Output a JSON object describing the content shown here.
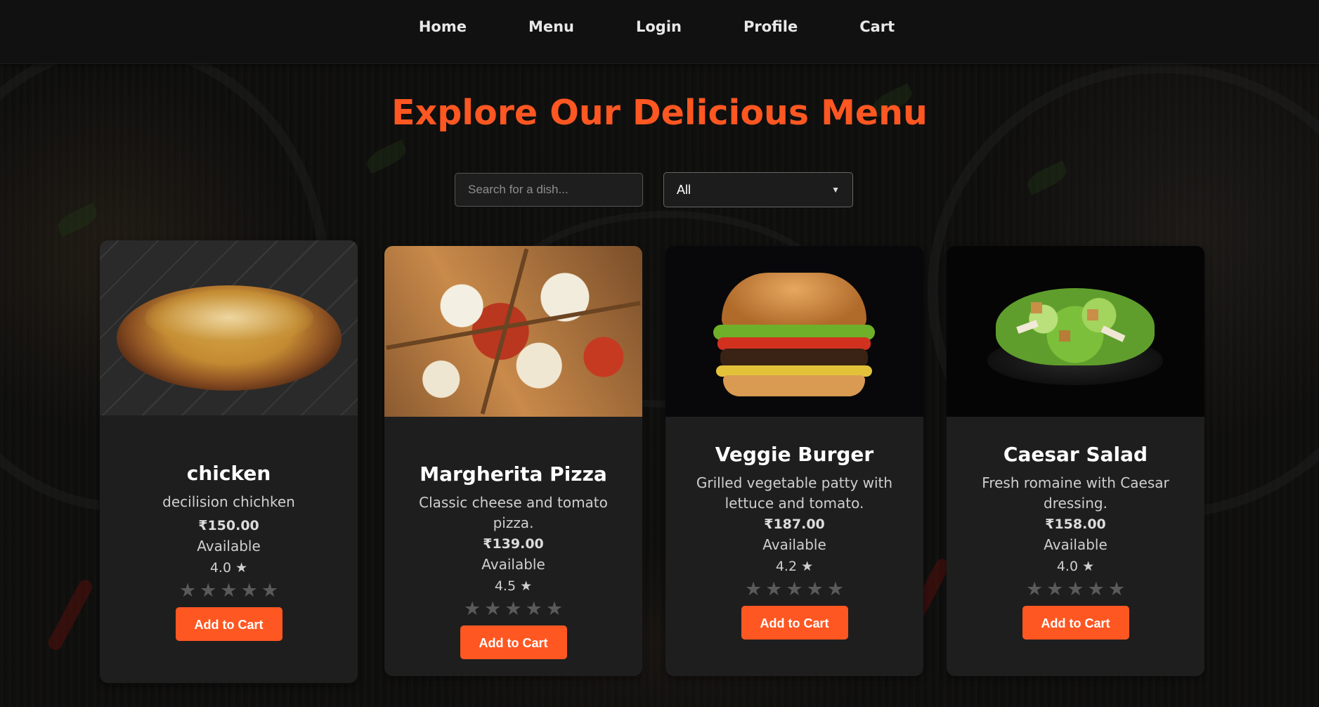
{
  "nav": {
    "items": [
      "Home",
      "Menu",
      "Login",
      "Profile",
      "Cart"
    ]
  },
  "page": {
    "title": "Explore Our Delicious Menu"
  },
  "search": {
    "placeholder": "Search for a dish..."
  },
  "filter": {
    "selected": "All"
  },
  "menu": [
    {
      "name": "chicken",
      "description": "decilision chichken",
      "price": "₹150.00",
      "status": "Available",
      "rating": "4.0 ★",
      "stars": 5,
      "button": "Add to Cart",
      "image_icon": "biryani-image"
    },
    {
      "name": "Margherita Pizza",
      "description": "Classic cheese and tomato pizza.",
      "price": "₹139.00",
      "status": "Available",
      "rating": "4.5 ★",
      "stars": 5,
      "button": "Add to Cart",
      "image_icon": "pizza-image"
    },
    {
      "name": "Veggie Burger",
      "description": "Grilled vegetable patty with lettuce and tomato.",
      "price": "₹187.00",
      "status": "Available",
      "rating": "4.2 ★",
      "stars": 5,
      "button": "Add to Cart",
      "image_icon": "burger-image"
    },
    {
      "name": "Caesar Salad",
      "description": "Fresh romaine with Caesar dressing.",
      "price": "₹158.00",
      "status": "Available",
      "rating": "4.0 ★",
      "stars": 5,
      "button": "Add to Cart",
      "image_icon": "salad-image"
    }
  ],
  "colors": {
    "accent": "#ff5722",
    "card_bg": "#1e1e1e",
    "nav_bg": "#111111"
  }
}
